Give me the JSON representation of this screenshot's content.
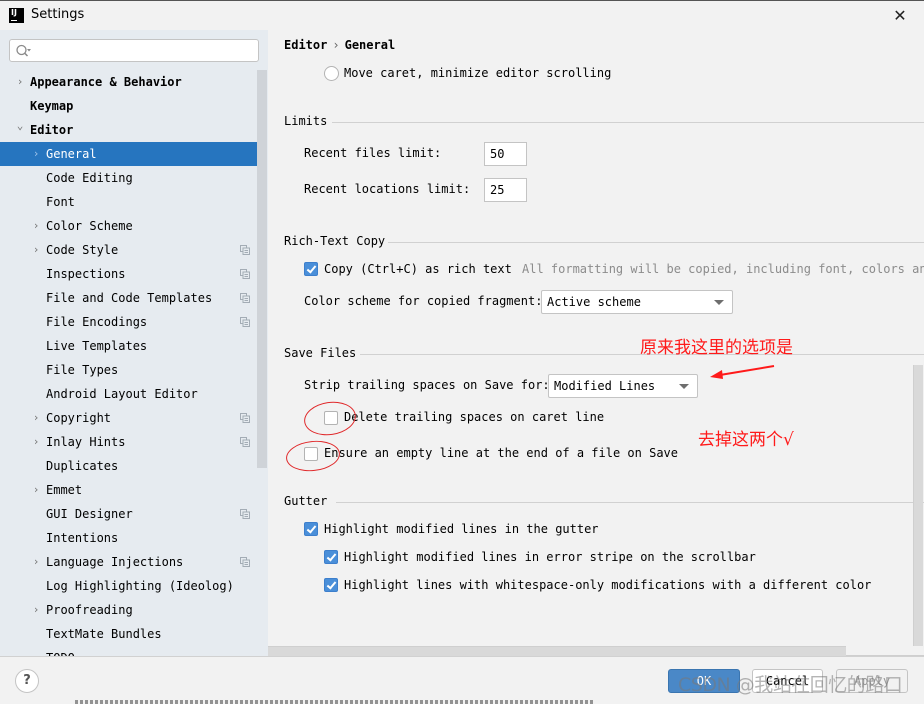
{
  "window": {
    "title": "Settings",
    "app_icon_label": "IJ",
    "close_glyph": "✕"
  },
  "sidebar": {
    "search": {
      "value": "",
      "placeholder": ""
    },
    "items": [
      {
        "label": "Appearance & Behavior",
        "level": 0,
        "expander": "collapsed",
        "bold": true,
        "selected": false,
        "project_icon": false
      },
      {
        "label": "Keymap",
        "level": 0,
        "expander": "none",
        "bold": true,
        "selected": false,
        "project_icon": false
      },
      {
        "label": "Editor",
        "level": 0,
        "expander": "expanded",
        "bold": true,
        "selected": false,
        "project_icon": false
      },
      {
        "label": "General",
        "level": 1,
        "expander": "collapsed",
        "bold": false,
        "selected": true,
        "project_icon": false
      },
      {
        "label": "Code Editing",
        "level": 1,
        "expander": "none",
        "bold": false,
        "selected": false,
        "project_icon": false
      },
      {
        "label": "Font",
        "level": 1,
        "expander": "none",
        "bold": false,
        "selected": false,
        "project_icon": false
      },
      {
        "label": "Color Scheme",
        "level": 1,
        "expander": "collapsed",
        "bold": false,
        "selected": false,
        "project_icon": false
      },
      {
        "label": "Code Style",
        "level": 1,
        "expander": "collapsed",
        "bold": false,
        "selected": false,
        "project_icon": true
      },
      {
        "label": "Inspections",
        "level": 1,
        "expander": "none",
        "bold": false,
        "selected": false,
        "project_icon": true
      },
      {
        "label": "File and Code Templates",
        "level": 1,
        "expander": "none",
        "bold": false,
        "selected": false,
        "project_icon": true
      },
      {
        "label": "File Encodings",
        "level": 1,
        "expander": "none",
        "bold": false,
        "selected": false,
        "project_icon": true
      },
      {
        "label": "Live Templates",
        "level": 1,
        "expander": "none",
        "bold": false,
        "selected": false,
        "project_icon": false
      },
      {
        "label": "File Types",
        "level": 1,
        "expander": "none",
        "bold": false,
        "selected": false,
        "project_icon": false
      },
      {
        "label": "Android Layout Editor",
        "level": 1,
        "expander": "none",
        "bold": false,
        "selected": false,
        "project_icon": false
      },
      {
        "label": "Copyright",
        "level": 1,
        "expander": "collapsed",
        "bold": false,
        "selected": false,
        "project_icon": true
      },
      {
        "label": "Inlay Hints",
        "level": 1,
        "expander": "collapsed",
        "bold": false,
        "selected": false,
        "project_icon": true
      },
      {
        "label": "Duplicates",
        "level": 1,
        "expander": "none",
        "bold": false,
        "selected": false,
        "project_icon": false
      },
      {
        "label": "Emmet",
        "level": 1,
        "expander": "collapsed",
        "bold": false,
        "selected": false,
        "project_icon": false
      },
      {
        "label": "GUI Designer",
        "level": 1,
        "expander": "none",
        "bold": false,
        "selected": false,
        "project_icon": true
      },
      {
        "label": "Intentions",
        "level": 1,
        "expander": "none",
        "bold": false,
        "selected": false,
        "project_icon": false
      },
      {
        "label": "Language Injections",
        "level": 1,
        "expander": "collapsed",
        "bold": false,
        "selected": false,
        "project_icon": true
      },
      {
        "label": "Log Highlighting (Ideolog)",
        "level": 1,
        "expander": "none",
        "bold": false,
        "selected": false,
        "project_icon": false
      },
      {
        "label": "Proofreading",
        "level": 1,
        "expander": "collapsed",
        "bold": false,
        "selected": false,
        "project_icon": false
      },
      {
        "label": "TextMate Bundles",
        "level": 1,
        "expander": "none",
        "bold": false,
        "selected": false,
        "project_icon": false
      },
      {
        "label": "TODO",
        "level": 1,
        "expander": "none",
        "bold": false,
        "selected": false,
        "project_icon": false
      }
    ]
  },
  "content": {
    "breadcrumb": {
      "parent": "Editor",
      "separator": "›",
      "current": "General"
    },
    "caret_radio": {
      "label": "Move caret, minimize editor scrolling",
      "selected": false
    },
    "limits": {
      "title": "Limits",
      "recent_files_label": "Recent files limit:",
      "recent_files_value": "50",
      "recent_locations_label": "Recent locations limit:",
      "recent_locations_value": "25"
    },
    "rich_text_copy": {
      "title": "Rich-Text Copy",
      "copy_label": "Copy (Ctrl+C) as rich text",
      "copy_checked": true,
      "copy_hint": "All formatting will be copied, including font, colors and",
      "scheme_label": "Color scheme for copied fragment:",
      "scheme_value": "Active scheme"
    },
    "save_files": {
      "title": "Save Files",
      "strip_label": "Strip trailing spaces on Save for:",
      "strip_value": "Modified Lines",
      "delete_trailing_label": "Delete trailing spaces on caret line",
      "delete_trailing_checked": false,
      "ensure_newline_label": "Ensure an empty line at the end of a file on Save",
      "ensure_newline_checked": false
    },
    "gutter": {
      "title": "Gutter",
      "highlight_gutter_label": "Highlight modified lines in the gutter",
      "highlight_gutter_checked": true,
      "highlight_stripe_label": "Highlight modified lines in error stripe on the scrollbar",
      "highlight_stripe_checked": true,
      "highlight_whitespace_label": "Highlight lines with whitespace-only modifications with a different color",
      "highlight_whitespace_checked": true
    }
  },
  "footer": {
    "help_label": "?",
    "ok_label": "OK",
    "cancel_label": "Cancel",
    "apply_label": "Apply",
    "apply_enabled": false
  },
  "annotations": {
    "note_original_option": "原来我这里的选项是",
    "note_uncheck_both": "去掉这两个√",
    "color": "#ff1a1a"
  },
  "watermark": "CSDN @我站在回忆的路口",
  "colors": {
    "selection": "#2675bf",
    "checkbox_on": "#4a8fd9",
    "ok_button": "#4a88c7",
    "sidebar_bg": "#e6ebf0",
    "panel_bg": "#f2f2f2"
  }
}
